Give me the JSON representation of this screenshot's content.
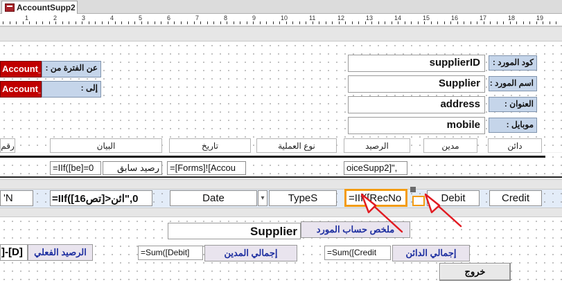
{
  "tab": {
    "label": "AccountSupp2"
  },
  "ruler": {
    "numbers": [
      "1",
      "2",
      "3",
      "4",
      "5",
      "6",
      "7",
      "8",
      "9",
      "10",
      "11",
      "12",
      "13",
      "14",
      "15",
      "16",
      "17",
      "18",
      "19"
    ]
  },
  "header": {
    "period_from_label": "عن الفترة من :",
    "period_from_value": "Account_Pa",
    "period_to_label": "إلى :",
    "period_to_value": "Account_Pa",
    "supplier_id_label": "كود المورد :",
    "supplier_id_value": "supplierID",
    "supplier_name_label": "اسم المورد :",
    "supplier_name_value": "Supplier",
    "address_label": "العنوان :",
    "address_value": "address",
    "mobile_label": "موبايل :",
    "mobile_value": "mobile"
  },
  "columns": {
    "number": "رقم",
    "description": "البيان",
    "date": "تاريخ",
    "operation_type": "نوع العملية",
    "balance": "الرصيد",
    "debit": "مدين",
    "credit": "دائن"
  },
  "group_row": {
    "formula_be": "=IIf([be]=0",
    "previous_balance": "رصيد سابق",
    "forms_ref": "=[Forms]![Accou",
    "invoice_ref": "oiceSupp2]\","
  },
  "detail_row": {
    "n_field": "'N",
    "iif_field": "=IIf([تص16]>0,\"ائن",
    "date_field": "Date",
    "types_field": "TypeS",
    "recno_field": "=IIf([RecNo",
    "debit_field": "Debit",
    "credit_field": "Credit"
  },
  "footer": {
    "supplier_value": "Supplier",
    "summary_label": "ملخص حساب المورد",
    "actual_balance_formula": "]-[D]",
    "actual_balance_label": "الرصيد الفعلي",
    "sum_debit_formula": "=Sum([Debit]",
    "total_debit_label": "إجمالي المدين",
    "sum_credit_formula": "=Sum([Credit",
    "total_credit_label": "إجمالي الدائن",
    "exit_button": "خروج"
  },
  "colors": {
    "selection_orange": "#f39c12",
    "annotation_red": "#e11b22",
    "accent_red": "#c00000",
    "label_blue": "#c5d5ea"
  }
}
